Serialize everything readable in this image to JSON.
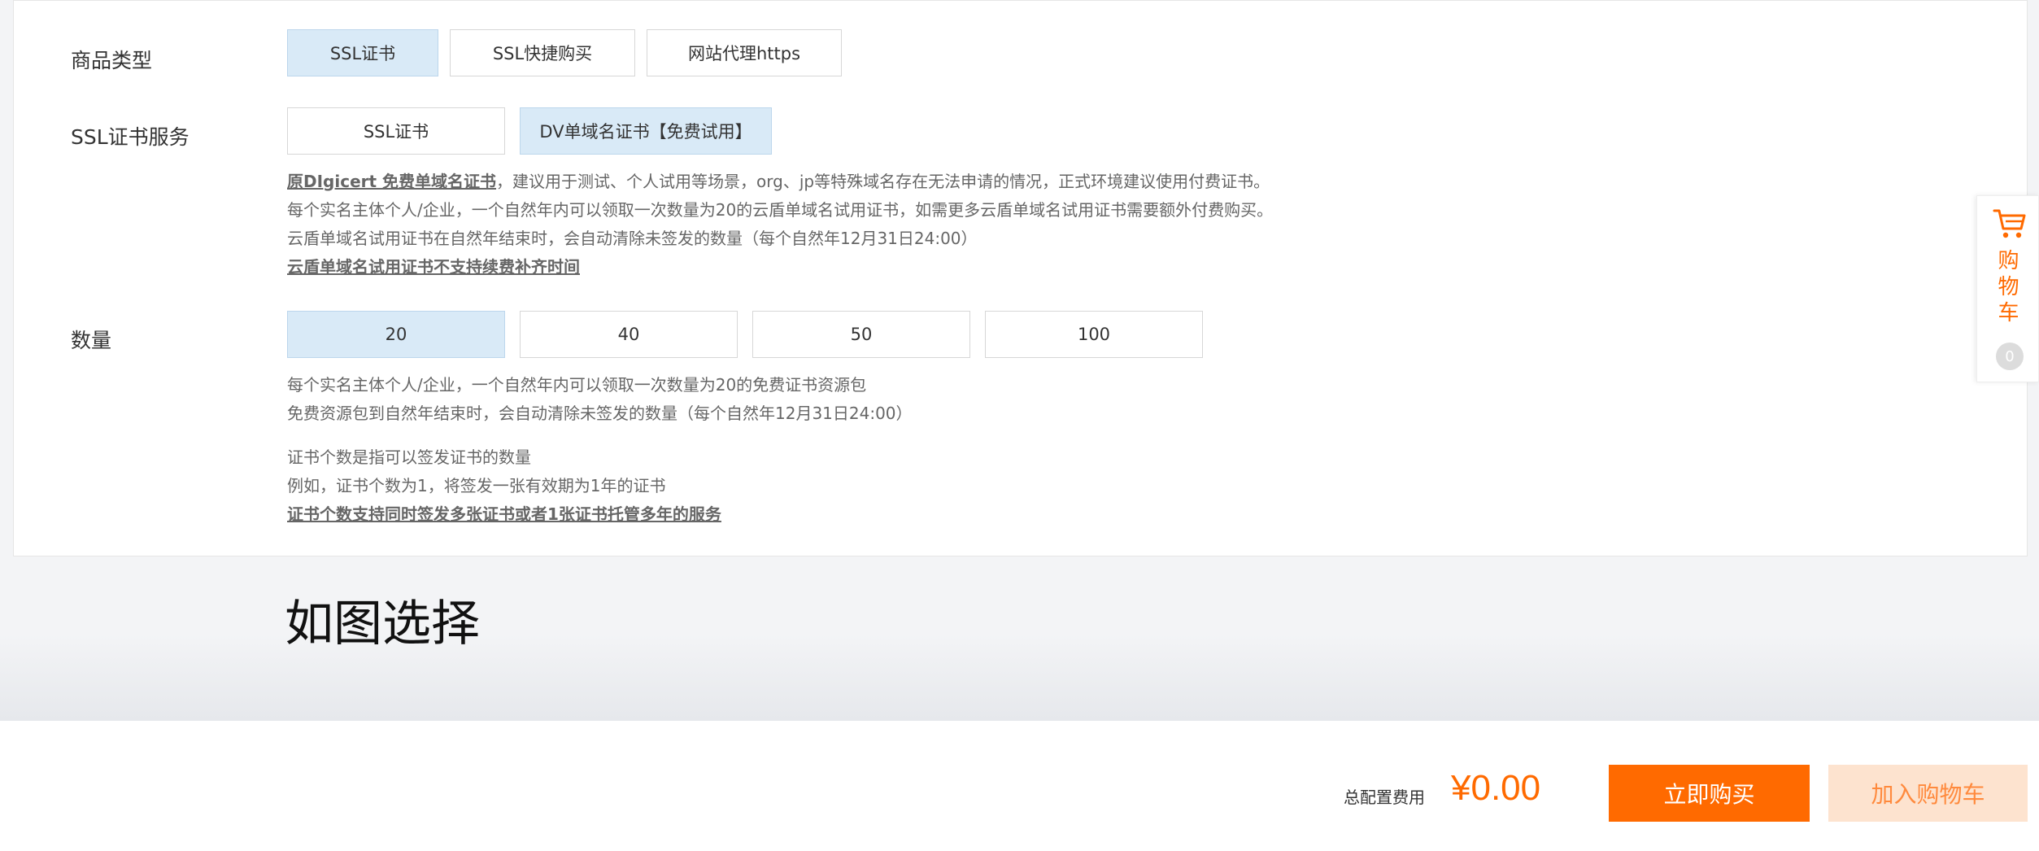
{
  "product_type": {
    "label": "商品类型",
    "options": [
      "SSL证书",
      "SSL快捷购买",
      "网站代理https"
    ],
    "selected": "SSL证书"
  },
  "ssl_service": {
    "label": "SSL证书服务",
    "options": [
      "SSL证书",
      "DV单域名证书【免费试用】"
    ],
    "selected": "DV单域名证书【免费试用】",
    "desc_bold": "原DIgicert 免费单域名证书",
    "desc_line1_rest": "，建议用于测试、个人试用等场景，org、jp等特殊域名存在无法申请的情况，正式环境建议使用付费证书。",
    "desc_line2": "每个实名主体个人/企业，一个自然年内可以领取一次数量为20的云盾单域名试用证书，如需更多云盾单域名试用证书需要额外付费购买。",
    "desc_line3": "云盾单域名试用证书在自然年结束时，会自动清除未签发的数量（每个自然年12月31日24:00）",
    "desc_line4": "云盾单域名试用证书不支持续费补齐时间"
  },
  "quantity": {
    "label": "数量",
    "options": [
      "20",
      "40",
      "50",
      "100"
    ],
    "selected": "20",
    "desc_line1": "每个实名主体个人/企业，一个自然年内可以领取一次数量为20的免费证书资源包",
    "desc_line2": "免费资源包到自然年结束时，会自动清除未签发的数量（每个自然年12月31日24:00）",
    "desc_line3": "证书个数是指可以签发证书的数量",
    "desc_line4": "例如，证书个数为1，将签发一张有效期为1年的证书",
    "desc_line5": "证书个数支持同时签发多张证书或者1张证书托管多年的服务"
  },
  "annotation": "如图选择",
  "cart": {
    "label": "购物车",
    "count": "0",
    "icon": "shopping-cart-icon"
  },
  "footer": {
    "total_label": "总配置费用",
    "total_price": "¥0.00",
    "buy_label": "立即购买",
    "add_cart_label": "加入购物车"
  },
  "colors": {
    "accent": "#ff6a00",
    "selected_bg": "#d9eaf7",
    "add_cart_bg": "#fde3cf"
  }
}
